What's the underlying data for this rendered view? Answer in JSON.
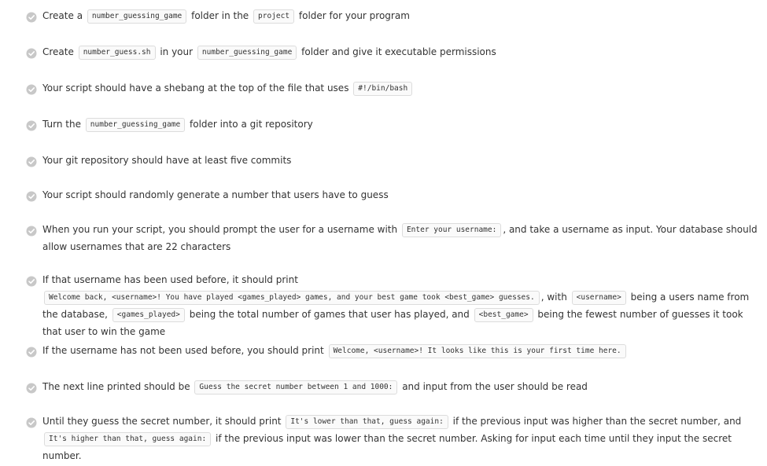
{
  "tasks": [
    {
      "status": "complete",
      "parts": [
        {
          "t": "Create a"
        },
        {
          "c": "number_guessing_game"
        },
        {
          "t": "folder in the"
        },
        {
          "c": "project"
        },
        {
          "t": "folder for your program"
        }
      ]
    },
    {
      "status": "complete",
      "parts": [
        {
          "t": "Create"
        },
        {
          "c": "number_guess.sh"
        },
        {
          "t": "in your"
        },
        {
          "c": "number_guessing_game"
        },
        {
          "t": "folder and give it executable permissions"
        }
      ]
    },
    {
      "status": "complete",
      "parts": [
        {
          "t": "Your script should have a shebang at the top of the file that uses"
        },
        {
          "c": "#!/bin/bash"
        }
      ]
    },
    {
      "status": "complete",
      "parts": [
        {
          "t": "Turn the"
        },
        {
          "c": "number_guessing_game"
        },
        {
          "t": "folder into a git repository"
        }
      ]
    },
    {
      "status": "complete",
      "parts": [
        {
          "t": "Your git repository should have at least five commits"
        }
      ]
    },
    {
      "status": "complete",
      "parts": [
        {
          "t": "Your script should randomly generate a number that users have to guess"
        }
      ]
    },
    {
      "status": "complete",
      "parts": [
        {
          "t": "When you run your script, you should prompt the user for a username with"
        },
        {
          "c": "Enter your username:"
        },
        {
          "t": ", and take a username as input. Your database should allow usernames that are 22 characters"
        }
      ]
    },
    {
      "status": "complete",
      "parts": [
        {
          "t": "If that username has been used before, it should print"
        },
        {
          "c": "Welcome back, <username>! You have played <games_played> games, and your best game took <best_game> guesses."
        },
        {
          "t": ", with"
        },
        {
          "c": "<username>"
        },
        {
          "t": "being a users name from the database,"
        },
        {
          "c": "<games_played>"
        },
        {
          "t": "being the total number of games that user has played, and"
        },
        {
          "c": "<best_game>"
        },
        {
          "t": "being the fewest number of guesses it took that user to win the game"
        }
      ]
    },
    {
      "status": "complete",
      "parts": [
        {
          "t": "If the username has not been used before, you should print"
        },
        {
          "c": "Welcome, <username>! It looks like this is your first time here."
        }
      ]
    },
    {
      "status": "complete",
      "parts": [
        {
          "t": "The next line printed should be"
        },
        {
          "c": "Guess the secret number between 1 and 1000:"
        },
        {
          "t": "and input from the user should be read"
        }
      ]
    },
    {
      "status": "complete",
      "parts": [
        {
          "t": "Until they guess the secret number, it should print"
        },
        {
          "c": "It's lower than that, guess again:"
        },
        {
          "t": "if the previous input was higher than the secret number, and"
        },
        {
          "c": "It's higher than that, guess again:"
        },
        {
          "t": "if the previous input was lower than the secret number. Asking for input each time until they input the secret number."
        }
      ]
    }
  ],
  "colors": {
    "check_fill": "#c8c8c8",
    "check_mark": "#ffffff",
    "text": "#333333",
    "code_bg": "#fafafa",
    "code_border": "#dcdcdc"
  },
  "icons": {
    "check": "check-circle-icon"
  }
}
